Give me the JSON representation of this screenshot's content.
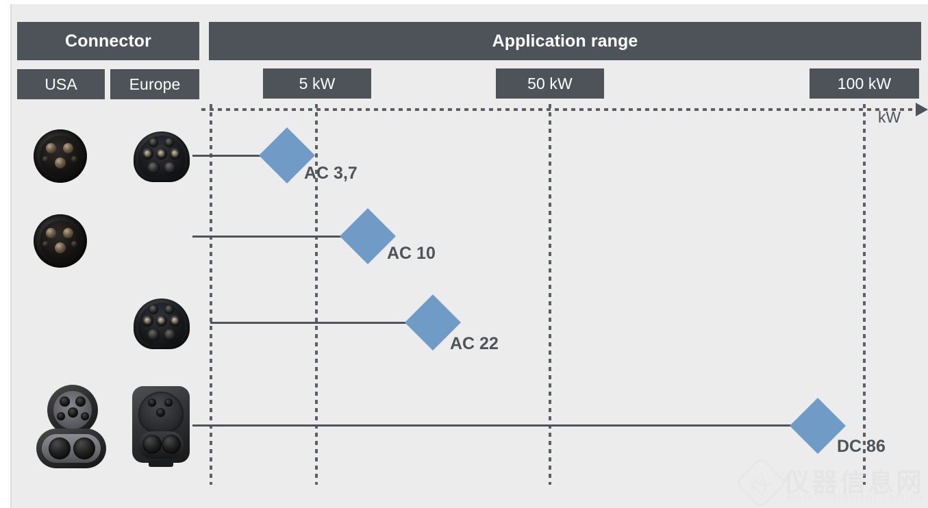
{
  "panel": {
    "background_color": "#ececec",
    "header_color": "#4d5358",
    "marker_color": "#6f9bc6"
  },
  "headers": {
    "connector": "Connector",
    "application_range": "Application range",
    "usa": "USA",
    "europe": "Europe"
  },
  "axis": {
    "unit": "kW",
    "ticks": [
      {
        "label": "5 kW",
        "value": 5
      },
      {
        "label": "50 kW",
        "value": 50
      },
      {
        "label": "100 kW",
        "value": 100
      }
    ]
  },
  "rows": [
    {
      "label": "AC 3,7",
      "power_kw": 3.7,
      "current_type": "AC",
      "usa_connector": "type-1-j1772-connector",
      "europe_connector": "type-2-mennekes-connector"
    },
    {
      "label": "AC 10",
      "power_kw": 10,
      "current_type": "AC",
      "usa_connector": "type-1-j1772-connector",
      "europe_connector": null
    },
    {
      "label": "AC 22",
      "power_kw": 22,
      "current_type": "AC",
      "usa_connector": null,
      "europe_connector": "type-2-mennekes-connector"
    },
    {
      "label": "DC 86",
      "power_kw": 86,
      "current_type": "DC",
      "usa_connector": "ccs1-combo-connector",
      "europe_connector": "ccs2-combo-connector"
    }
  ],
  "chart_data": {
    "type": "scatter",
    "title": "Application range",
    "xlabel": "kW",
    "ylabel": "Connector",
    "categories": [
      "AC 3,7",
      "AC 10",
      "AC 22",
      "DC 86"
    ],
    "values": [
      3.7,
      10,
      22,
      86
    ],
    "x_ticks": [
      5,
      50,
      100
    ],
    "x_tick_labels": [
      "5 kW",
      "50 kW",
      "100 kW"
    ],
    "xlim": [
      0,
      110
    ],
    "grid": "vertical-dotted",
    "legend": "none",
    "marker": "diamond",
    "marker_color": "#6f9bc6"
  },
  "watermark": {
    "text_cn": "仪器信息网",
    "url": "www.instrument.com.cn",
    "logo_glyph": "仪"
  }
}
